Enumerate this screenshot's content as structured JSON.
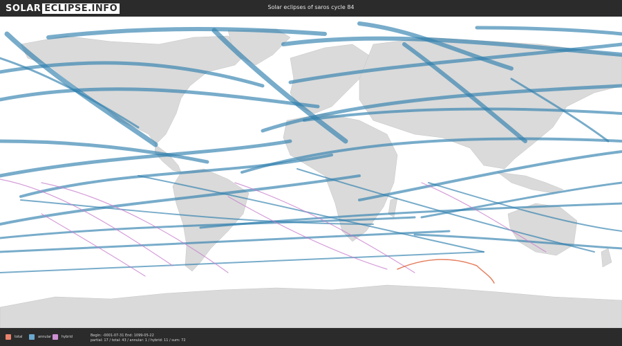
{
  "header": {
    "logo_part1": "SOLAR",
    "logo_part2": "ECLIPSE.INFO",
    "title": "Solar eclipses of saros cycle 84"
  },
  "legend": {
    "items": [
      {
        "label": "total",
        "color": "#e8836c"
      },
      {
        "label": "annular",
        "color": "#6aa8cf"
      },
      {
        "label": "hybrid",
        "color": "#cf8fd4"
      }
    ]
  },
  "info": {
    "range": "Begin: -0001-07-31 End: 1099-05-22",
    "counts": "partial: 17 / total: 43 / annular: 1 / hybrid: 11 / sum: 72"
  },
  "map": {
    "land_color": "#dadada",
    "ocean_color": "#ffffff",
    "annular_color": "#2f7fad",
    "total_color": "#e06a45",
    "hybrid_color": "#c77ccc"
  }
}
